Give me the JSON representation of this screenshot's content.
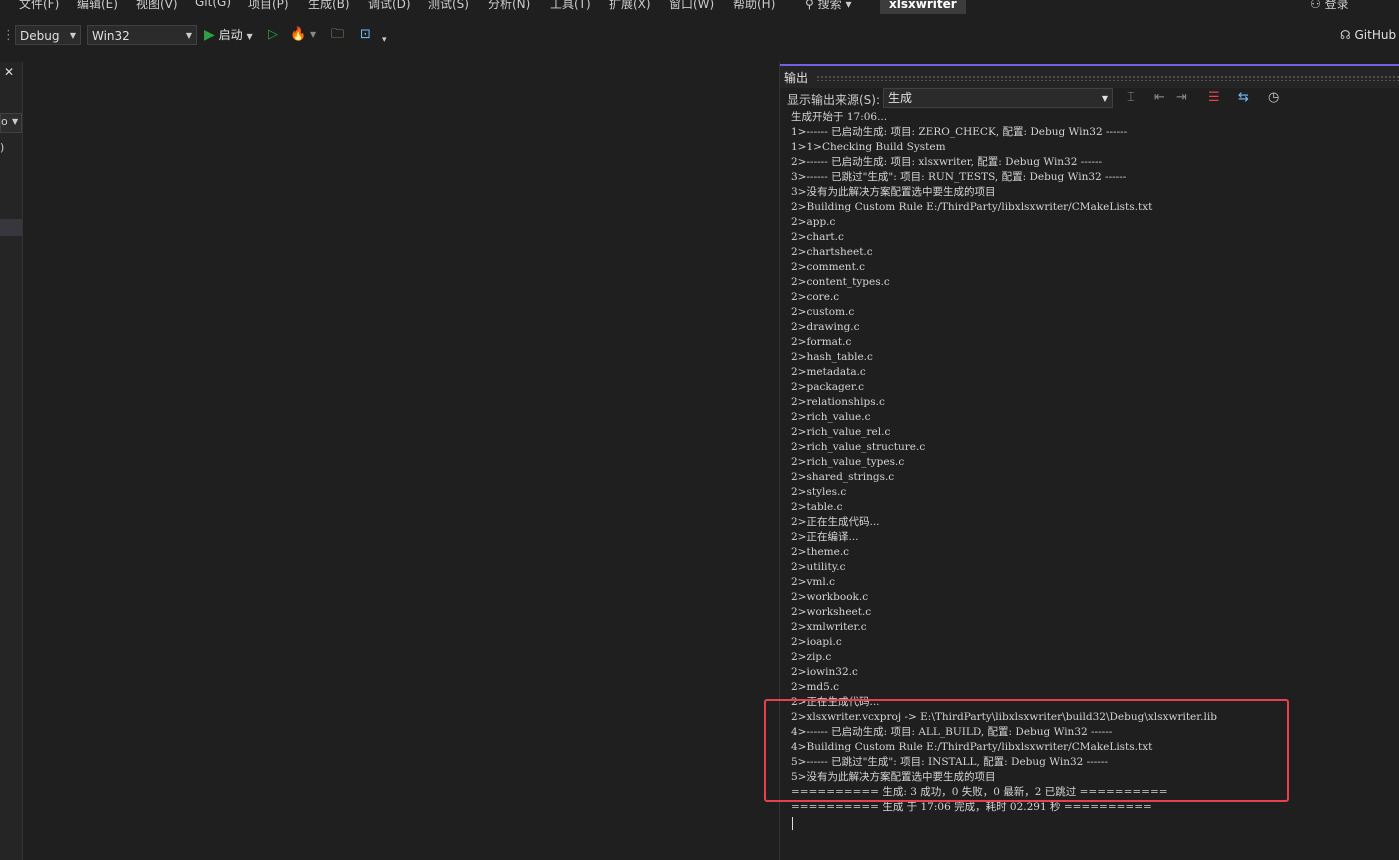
{
  "menubar": {
    "items": [
      "文件(F)",
      "编辑(E)",
      "视图(V)",
      "Git(G)",
      "项目(P)",
      "生成(B)",
      "调试(D)",
      "测试(S)",
      "分析(N)",
      "工具(T)",
      "扩展(X)",
      "窗口(W)",
      "帮助(H)"
    ],
    "search_label": "搜索",
    "repo_name": "xlsxwriter",
    "login_label": "登录"
  },
  "toolbar": {
    "config": "Debug",
    "platform": "Win32",
    "start_label": "启动",
    "github_label": "GitHub"
  },
  "left_pane": {
    "close_glyph": "✕",
    "fragment_1": "o",
    "fragment_2": ")"
  },
  "output": {
    "title": "输出",
    "source_label": "显示输出来源(S):",
    "source_value": "生成",
    "lines": [
      "生成开始于 17:06...",
      "1>------ 已启动生成: 项目: ZERO_CHECK, 配置: Debug Win32 ------",
      "1>1>Checking Build System",
      "2>------ 已启动生成: 项目: xlsxwriter, 配置: Debug Win32 ------",
      "3>------ 已跳过\"生成\": 项目: RUN_TESTS, 配置: Debug Win32 ------",
      "3>没有为此解决方案配置选中要生成的项目",
      "2>Building Custom Rule E:/ThirdParty/libxlsxwriter/CMakeLists.txt",
      "2>app.c",
      "2>chart.c",
      "2>chartsheet.c",
      "2>comment.c",
      "2>content_types.c",
      "2>core.c",
      "2>custom.c",
      "2>drawing.c",
      "2>format.c",
      "2>hash_table.c",
      "2>metadata.c",
      "2>packager.c",
      "2>relationships.c",
      "2>rich_value.c",
      "2>rich_value_rel.c",
      "2>rich_value_structure.c",
      "2>rich_value_types.c",
      "2>shared_strings.c",
      "2>styles.c",
      "2>table.c",
      "2>正在生成代码...",
      "2>正在编译...",
      "2>theme.c",
      "2>utility.c",
      "2>vml.c",
      "2>workbook.c",
      "2>worksheet.c",
      "2>xmlwriter.c",
      "2>ioapi.c",
      "2>zip.c",
      "2>iowin32.c",
      "2>md5.c",
      "2>正在生成代码...",
      "2>xlsxwriter.vcxproj -> E:\\ThirdParty\\libxlsxwriter\\build32\\Debug\\xlsxwriter.lib",
      "4>------ 已启动生成: 项目: ALL_BUILD, 配置: Debug Win32 ------",
      "4>Building Custom Rule E:/ThirdParty/libxlsxwriter/CMakeLists.txt",
      "5>------ 已跳过\"生成\": 项目: INSTALL, 配置: Debug Win32 ------",
      "5>没有为此解决方案配置选中要生成的项目",
      "========== 生成: 3 成功，0 失败，0 最新，2 已跳过 ==========",
      "========== 生成 于 17:06 完成，耗时 02.291 秒 =========="
    ]
  },
  "colors": {
    "highlight_border": "#e5424c",
    "panel_accent": "#7160e8",
    "start_green": "#2ea043"
  }
}
